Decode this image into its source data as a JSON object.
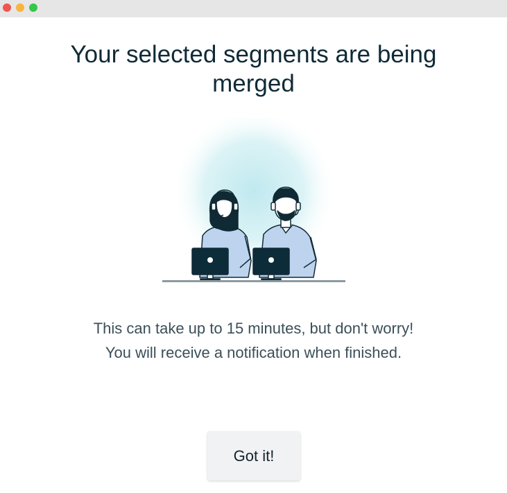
{
  "dialog": {
    "title": "Your selected segments are being merged",
    "message_line_1": "This can take up to 15 minutes, but don't worry!",
    "message_line_2": "You will receive a notification when finished.",
    "button_label": "Got it!"
  },
  "illustration": {
    "subject": "two support agents with headsets working at computers",
    "icon": "support-agents-illustration"
  },
  "colors": {
    "title": "#0f2a36",
    "body_text": "#3b4f58",
    "button_bg": "#f1f2f4",
    "glow": "#bfe9ef",
    "shirt": "#bdd3ee",
    "monitor": "#0d2c3a"
  }
}
